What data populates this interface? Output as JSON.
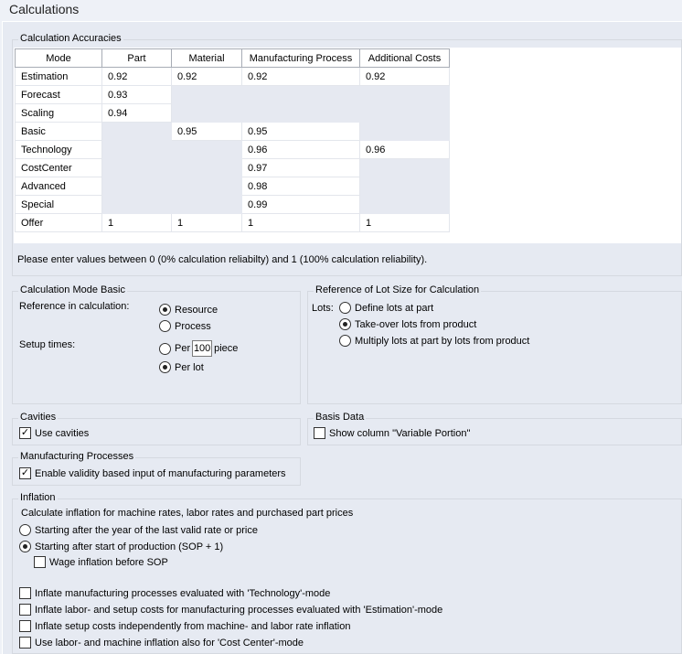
{
  "title": "Calculations",
  "accuracies": {
    "legend": "Calculation Accuracies",
    "headers": [
      "Mode",
      "Part",
      "Material",
      "Manufacturing Process",
      "Additional Costs"
    ],
    "rows": [
      {
        "mode": "Estimation",
        "cells": [
          "0.92",
          "0.92",
          "0.92",
          "0.92"
        ]
      },
      {
        "mode": "Forecast",
        "cells": [
          "0.93",
          null,
          null,
          null
        ]
      },
      {
        "mode": "Scaling",
        "cells": [
          "0.94",
          null,
          null,
          null
        ]
      },
      {
        "mode": "Basic",
        "cells": [
          null,
          "0.95",
          "0.95",
          null
        ]
      },
      {
        "mode": "Technology",
        "cells": [
          null,
          null,
          "0.96",
          "0.96"
        ]
      },
      {
        "mode": "CostCenter",
        "cells": [
          null,
          null,
          "0.97",
          null
        ]
      },
      {
        "mode": "Advanced",
        "cells": [
          null,
          null,
          "0.98",
          null
        ]
      },
      {
        "mode": "Special",
        "cells": [
          null,
          null,
          "0.99",
          null
        ]
      },
      {
        "mode": "Offer",
        "cells": [
          "1",
          "1",
          "1",
          "1"
        ]
      }
    ],
    "hint": "Please enter values between 0 (0% calculation reliabilty) and 1 (100% calculation reliability)."
  },
  "basic": {
    "legend": "Calculation Mode Basic",
    "reference_label": "Reference in calculation:",
    "resource": "Resource",
    "process": "Process",
    "setup_label": "Setup times:",
    "per": "Per",
    "per_value": "100",
    "piece": "piece",
    "per_lot": "Per lot",
    "reference_selected": "Resource",
    "setup_selected": "Per lot"
  },
  "lots": {
    "legend": "Reference of Lot Size for Calculation",
    "label": "Lots:",
    "options": [
      "Define lots at part",
      "Take-over lots from product",
      "Multiply lots at part by lots from product"
    ],
    "selected": 1
  },
  "cavities": {
    "legend": "Cavities",
    "use": "Use cavities",
    "checked": true
  },
  "basis": {
    "legend": "Basis Data",
    "show": "Show column \"Variable Portion\"",
    "checked": false
  },
  "mfg": {
    "legend": "Manufacturing Processes",
    "enable": "Enable validity based input of manufacturing parameters",
    "checked": true
  },
  "inflation": {
    "legend": "Inflation",
    "desc": "Calculate inflation for machine rates, labor rates and purchased part prices",
    "opt1": "Starting after the year of the last valid rate or price",
    "opt2": "Starting after start of production (SOP + 1)",
    "selected": 2,
    "wage": "Wage inflation before SOP",
    "checks": [
      "Inflate manufacturing processes evaluated with 'Technology'-mode",
      "Inflate labor- and setup costs for manufacturing processes evaluated with 'Estimation'-mode",
      "Inflate setup costs independently from machine- and labor rate inflation",
      "Use labor- and machine inflation also for 'Cost Center'-mode"
    ]
  }
}
